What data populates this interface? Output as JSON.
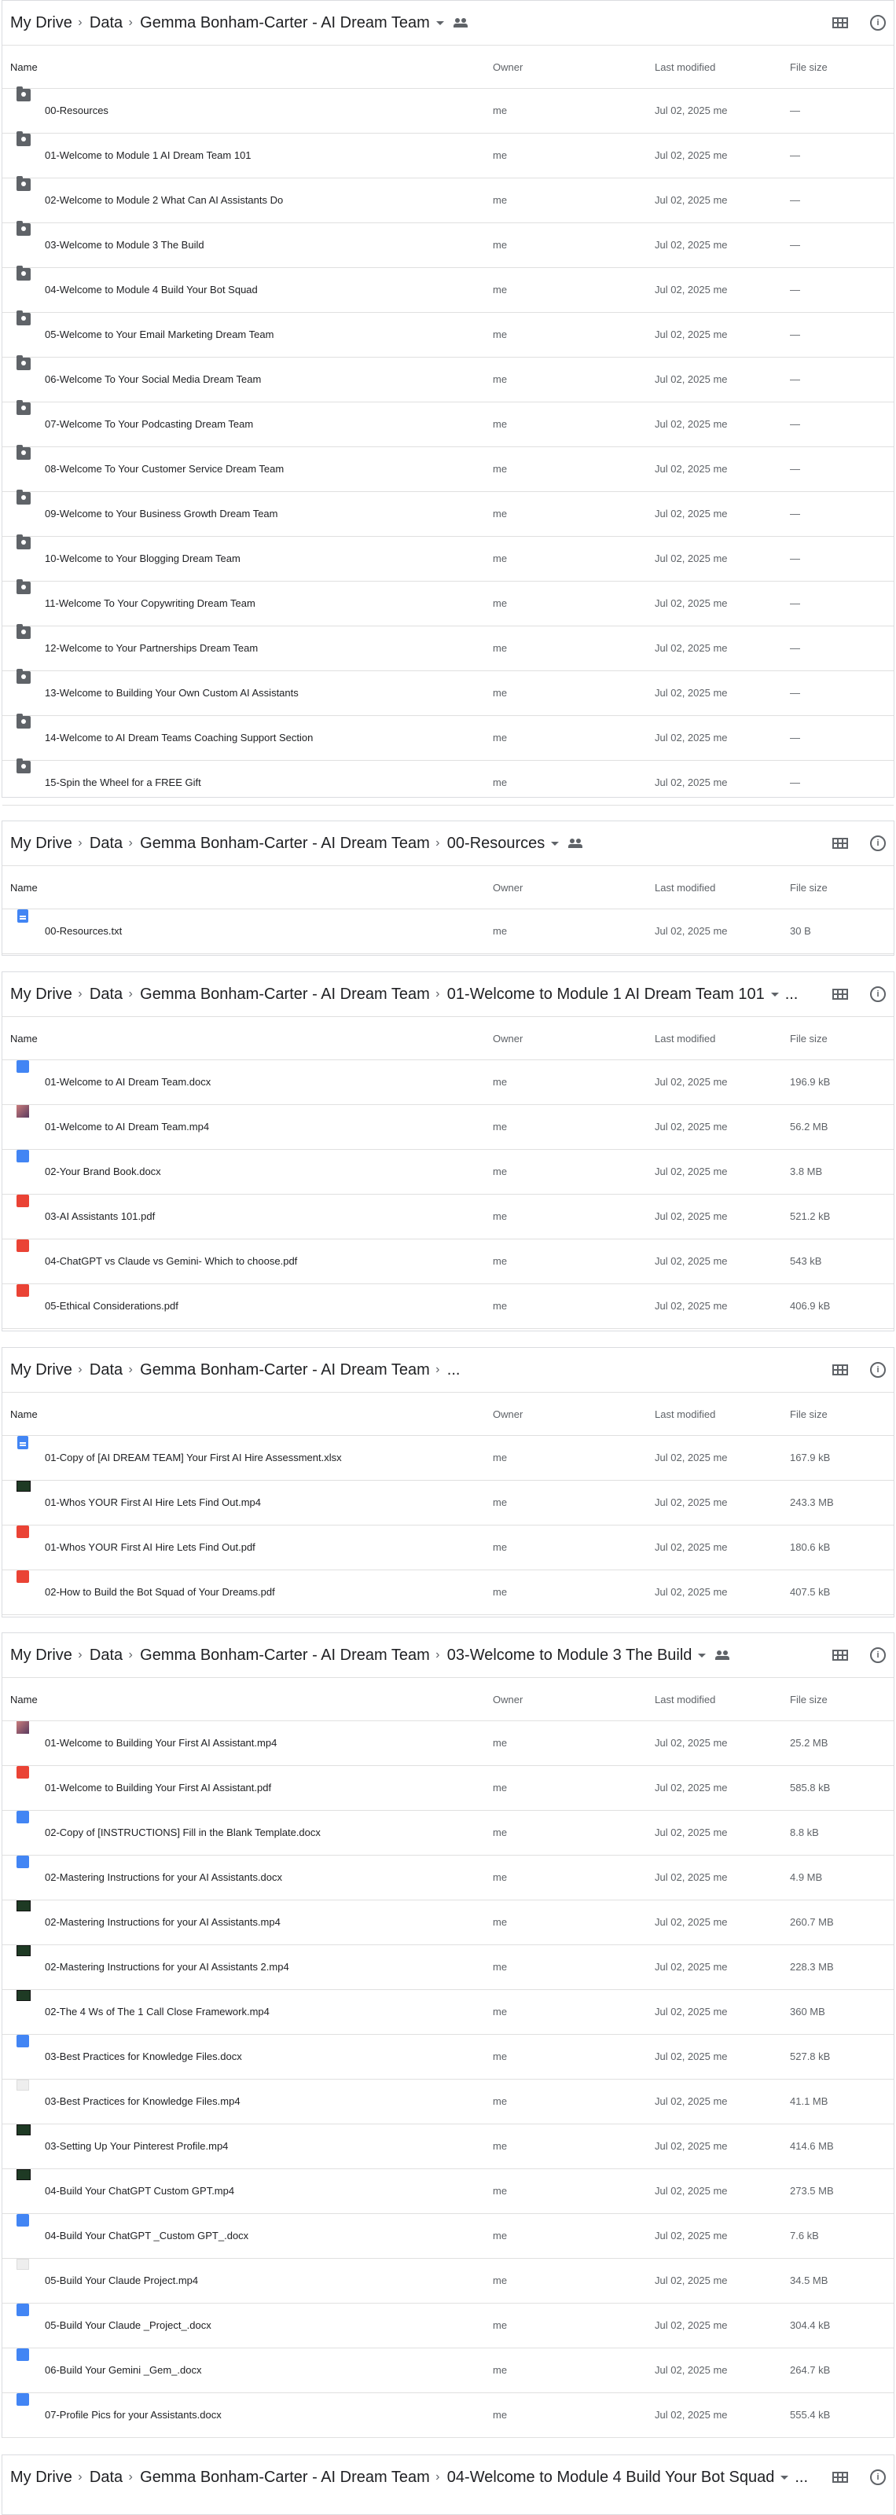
{
  "columns": {
    "name": "Name",
    "owner": "Owner",
    "modified": "Last modified",
    "size": "File size"
  },
  "panels": [
    {
      "breadcrumb": [
        "My Drive",
        "Data",
        "Gemma Bonham-Carter - AI Dream Team"
      ],
      "caret": true,
      "shared": true,
      "rows": [
        {
          "icon": "folder",
          "name": "00-Resources",
          "owner": "me",
          "modified": "Jul 02, 2025 me",
          "size": "—"
        },
        {
          "icon": "folder",
          "name": "01-Welcome to Module 1 AI Dream Team 101",
          "owner": "me",
          "modified": "Jul 02, 2025 me",
          "size": "—"
        },
        {
          "icon": "folder",
          "name": "02-Welcome to Module 2 What Can AI Assistants Do",
          "owner": "me",
          "modified": "Jul 02, 2025 me",
          "size": "—"
        },
        {
          "icon": "folder",
          "name": "03-Welcome to Module 3 The Build",
          "owner": "me",
          "modified": "Jul 02, 2025 me",
          "size": "—"
        },
        {
          "icon": "folder",
          "name": "04-Welcome to Module 4 Build Your Bot Squad",
          "owner": "me",
          "modified": "Jul 02, 2025 me",
          "size": "—"
        },
        {
          "icon": "folder",
          "name": "05-Welcome to Your Email Marketing Dream Team",
          "owner": "me",
          "modified": "Jul 02, 2025 me",
          "size": "—"
        },
        {
          "icon": "folder",
          "name": "06-Welcome To Your Social Media Dream Team",
          "owner": "me",
          "modified": "Jul 02, 2025 me",
          "size": "—"
        },
        {
          "icon": "folder",
          "name": "07-Welcome To Your Podcasting Dream Team",
          "owner": "me",
          "modified": "Jul 02, 2025 me",
          "size": "—"
        },
        {
          "icon": "folder",
          "name": "08-Welcome To Your Customer Service Dream Team",
          "owner": "me",
          "modified": "Jul 02, 2025 me",
          "size": "—"
        },
        {
          "icon": "folder",
          "name": "09-Welcome to Your Business Growth Dream Team",
          "owner": "me",
          "modified": "Jul 02, 2025 me",
          "size": "—"
        },
        {
          "icon": "folder",
          "name": "10-Welcome to Your Blogging Dream Team",
          "owner": "me",
          "modified": "Jul 02, 2025 me",
          "size": "—"
        },
        {
          "icon": "folder",
          "name": "11-Welcome To Your Copywriting Dream Team",
          "owner": "me",
          "modified": "Jul 02, 2025 me",
          "size": "—"
        },
        {
          "icon": "folder",
          "name": "12-Welcome to Your Partnerships Dream Team",
          "owner": "me",
          "modified": "Jul 02, 2025 me",
          "size": "—"
        },
        {
          "icon": "folder",
          "name": "13-Welcome to Building Your Own Custom AI Assistants",
          "owner": "me",
          "modified": "Jul 02, 2025 me",
          "size": "—"
        },
        {
          "icon": "folder",
          "name": "14-Welcome to AI Dream Teams Coaching Support Section",
          "owner": "me",
          "modified": "Jul 02, 2025 me",
          "size": "—"
        },
        {
          "icon": "folder",
          "name": "15-Spin the Wheel for a FREE Gift",
          "owner": "me",
          "modified": "Jul 02, 2025 me",
          "size": "—"
        }
      ]
    },
    {
      "breadcrumb": [
        "My Drive",
        "Data",
        "Gemma Bonham-Carter - AI Dream Team",
        "00-Resources"
      ],
      "caret": true,
      "shared": true,
      "rows": [
        {
          "icon": "doc",
          "name": "00-Resources.txt",
          "owner": "me",
          "modified": "Jul 02, 2025 me",
          "size": "30 B"
        }
      ]
    },
    {
      "breadcrumb": [
        "My Drive",
        "Data",
        "Gemma Bonham-Carter - AI Dream Team",
        "01-Welcome to Module 1 AI Dream Team 101"
      ],
      "caret": true,
      "shared": false,
      "ellipsis": "...",
      "rows": [
        {
          "icon": "word",
          "name": "01-Welcome to AI Dream Team.docx",
          "owner": "me",
          "modified": "Jul 02, 2025 me",
          "size": "196.9 kB"
        },
        {
          "icon": "vid2",
          "name": "01-Welcome to AI Dream Team.mp4",
          "owner": "me",
          "modified": "Jul 02, 2025 me",
          "size": "56.2 MB"
        },
        {
          "icon": "word",
          "name": "02-Your Brand Book.docx",
          "owner": "me",
          "modified": "Jul 02, 2025 me",
          "size": "3.8 MB"
        },
        {
          "icon": "pdf",
          "name": "03-AI Assistants 101.pdf",
          "owner": "me",
          "modified": "Jul 02, 2025 me",
          "size": "521.2 kB"
        },
        {
          "icon": "pdf",
          "name": "04-ChatGPT vs Claude vs Gemini- Which to choose.pdf",
          "owner": "me",
          "modified": "Jul 02, 2025 me",
          "size": "543 kB"
        },
        {
          "icon": "pdf",
          "name": "05-Ethical Considerations.pdf",
          "owner": "me",
          "modified": "Jul 02, 2025 me",
          "size": "406.9 kB"
        }
      ]
    },
    {
      "breadcrumb": [
        "My Drive",
        "Data",
        "Gemma Bonham-Carter - AI Dream Team",
        "..."
      ],
      "caret": false,
      "shared": false,
      "rows": [
        {
          "icon": "doc",
          "name": "01-Copy of [AI DREAM TEAM] Your First AI Hire Assessment.xlsx",
          "owner": "me",
          "modified": "Jul 02, 2025 me",
          "size": "167.9 kB"
        },
        {
          "icon": "vid",
          "name": "01-Whos YOUR First AI Hire Lets Find Out.mp4",
          "owner": "me",
          "modified": "Jul 02, 2025 me",
          "size": "243.3 MB"
        },
        {
          "icon": "pdf",
          "name": "01-Whos YOUR First AI Hire Lets Find Out.pdf",
          "owner": "me",
          "modified": "Jul 02, 2025 me",
          "size": "180.6 kB"
        },
        {
          "icon": "pdf",
          "name": "02-How to Build the Bot Squad of Your Dreams.pdf",
          "owner": "me",
          "modified": "Jul 02, 2025 me",
          "size": "407.5 kB"
        }
      ]
    },
    {
      "breadcrumb": [
        "My Drive",
        "Data",
        "Gemma Bonham-Carter - AI Dream Team",
        "03-Welcome to Module 3 The Build"
      ],
      "caret": true,
      "shared": true,
      "rows": [
        {
          "icon": "vid2",
          "name": "01-Welcome to Building Your First AI Assistant.mp4",
          "owner": "me",
          "modified": "Jul 02, 2025 me",
          "size": "25.2 MB"
        },
        {
          "icon": "pdf",
          "name": "01-Welcome to Building Your First AI Assistant.pdf",
          "owner": "me",
          "modified": "Jul 02, 2025 me",
          "size": "585.8 kB"
        },
        {
          "icon": "word",
          "name": "02-Copy of [INSTRUCTIONS] Fill in the Blank Template.docx",
          "owner": "me",
          "modified": "Jul 02, 2025 me",
          "size": "8.8 kB"
        },
        {
          "icon": "word",
          "name": "02-Mastering Instructions for your AI Assistants.docx",
          "owner": "me",
          "modified": "Jul 02, 2025 me",
          "size": "4.9 MB"
        },
        {
          "icon": "vid",
          "name": "02-Mastering Instructions for your AI Assistants.mp4",
          "owner": "me",
          "modified": "Jul 02, 2025 me",
          "size": "260.7 MB"
        },
        {
          "icon": "vid",
          "name": "02-Mastering Instructions for your AI Assistants 2.mp4",
          "owner": "me",
          "modified": "Jul 02, 2025 me",
          "size": "228.3 MB"
        },
        {
          "icon": "vid",
          "name": "02-The 4 Ws of The 1 Call Close Framework.mp4",
          "owner": "me",
          "modified": "Jul 02, 2025 me",
          "size": "360 MB"
        },
        {
          "icon": "word",
          "name": "03-Best Practices for Knowledge Files.docx",
          "owner": "me",
          "modified": "Jul 02, 2025 me",
          "size": "527.8 kB"
        },
        {
          "icon": "blank",
          "name": "03-Best Practices for Knowledge Files.mp4",
          "owner": "me",
          "modified": "Jul 02, 2025 me",
          "size": "41.1 MB"
        },
        {
          "icon": "vid",
          "name": "03-Setting Up Your Pinterest Profile.mp4",
          "owner": "me",
          "modified": "Jul 02, 2025 me",
          "size": "414.6 MB"
        },
        {
          "icon": "vid",
          "name": "04-Build Your ChatGPT Custom GPT.mp4",
          "owner": "me",
          "modified": "Jul 02, 2025 me",
          "size": "273.5 MB"
        },
        {
          "icon": "word",
          "name": "04-Build Your ChatGPT _Custom GPT_.docx",
          "owner": "me",
          "modified": "Jul 02, 2025 me",
          "size": "7.6 kB"
        },
        {
          "icon": "blank",
          "name": "05-Build Your Claude Project.mp4",
          "owner": "me",
          "modified": "Jul 02, 2025 me",
          "size": "34.5 MB"
        },
        {
          "icon": "word",
          "name": "05-Build Your Claude _Project_.docx",
          "owner": "me",
          "modified": "Jul 02, 2025 me",
          "size": "304.4 kB"
        },
        {
          "icon": "word",
          "name": "06-Build Your Gemini _Gem_.docx",
          "owner": "me",
          "modified": "Jul 02, 2025 me",
          "size": "264.7 kB"
        },
        {
          "icon": "word",
          "name": "07-Profile Pics for your Assistants.docx",
          "owner": "me",
          "modified": "Jul 02, 2025 me",
          "size": "555.4 kB"
        }
      ]
    },
    {
      "breadcrumb": [
        "My Drive",
        "Data",
        "Gemma Bonham-Carter - AI Dream Team",
        "04-Welcome to Module 4 Build Your Bot Squad"
      ],
      "caret": true,
      "shared": false,
      "ellipsis": "...",
      "rows": []
    }
  ]
}
